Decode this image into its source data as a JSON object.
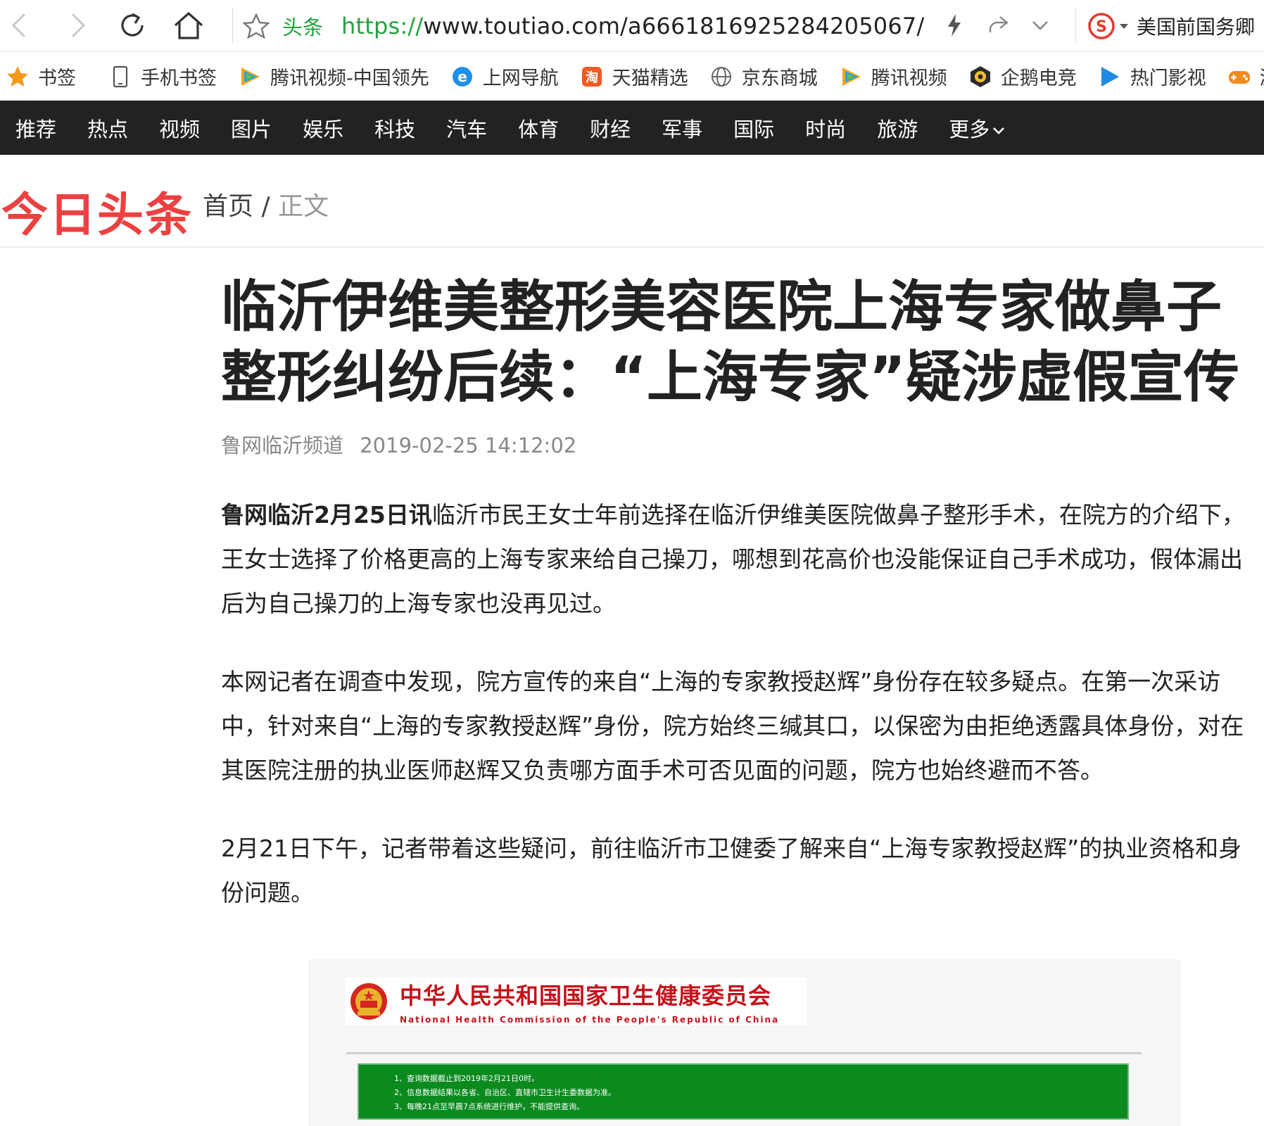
{
  "browser": {
    "site_label": "头条",
    "url_scheme": "https://",
    "url_rest": "www.toutiao.com/a6661816925284205067/",
    "search_text": "美国前国务卿",
    "accent": "#23a23b"
  },
  "bookmarks": {
    "items": [
      {
        "label": "书签",
        "icon": "star-icon"
      },
      {
        "label": "手机书签",
        "icon": "phone-icon"
      },
      {
        "label": "腾讯视频-中国领先",
        "icon": "tencent-video-icon"
      },
      {
        "label": "上网导航",
        "icon": "ie-icon"
      },
      {
        "label": "天猫精选",
        "icon": "tmall-icon"
      },
      {
        "label": "京东商城",
        "icon": "globe-icon"
      },
      {
        "label": "腾讯视频",
        "icon": "tencent-video-icon"
      },
      {
        "label": "企鹅电竞",
        "icon": "esports-icon"
      },
      {
        "label": "热门影视",
        "icon": "play-icon"
      },
      {
        "label": "游",
        "icon": "gamepad-icon"
      }
    ]
  },
  "nav": {
    "items": [
      "推荐",
      "热点",
      "视频",
      "图片",
      "娱乐",
      "科技",
      "汽车",
      "体育",
      "财经",
      "军事",
      "国际",
      "时尚",
      "旅游",
      "更多"
    ]
  },
  "header": {
    "logo": "今日头条",
    "breadcrumb_home": "首页",
    "breadcrumb_sep": "/",
    "breadcrumb_current": "正文",
    "logo_color": "#ed4040"
  },
  "article": {
    "title": "临沂伊维美整形美容医院上海专家做鼻子整形纠纷后续：“上海专家”疑涉虚假宣传",
    "source": "鲁网临沂频道",
    "time": "2019-02-25 14:12:02",
    "p1_lead": "鲁网临沂2月25日讯",
    "p1_body": "临沂市民王女士年前选择在临沂伊维美医院做鼻子整形手术，在院方的介绍下，王女士选择了价格更高的上海专家来给自己操刀，哪想到花高价也没能保证自己手术成功，假体漏出后为自己操刀的上海专家也没再见过。",
    "p2": "本网记者在调查中发现，院方宣传的来自“上海的专家教授赵辉”身份存在较多疑点。在第一次采访中，针对来自“上海的专家教授赵辉”身份，院方始终三缄其口，以保密为由拒绝透露具体身份，对在其医院注册的执业医师赵辉又负责哪方面手术可否见面的问题，院方也始终避而不答。",
    "p3": "2月21日下午，记者带着这些疑问，前往临沂市卫健委了解来自“上海专家教授赵辉”的执业资格和身份问题。"
  },
  "embed": {
    "org_cn": "中华人民共和国国家卫生健康委员会",
    "org_en": "National Health Commission of the People's Republic of China",
    "notices": [
      "1、查询数据截止到2019年2月21日0时。",
      "2、信息数据结果以各省、自治区、直辖市卫生计生委数据为准。",
      "3、每晚21点至早晨7点系统进行维护，不能提供查询。"
    ],
    "notice_color": "#0b8a1e"
  }
}
